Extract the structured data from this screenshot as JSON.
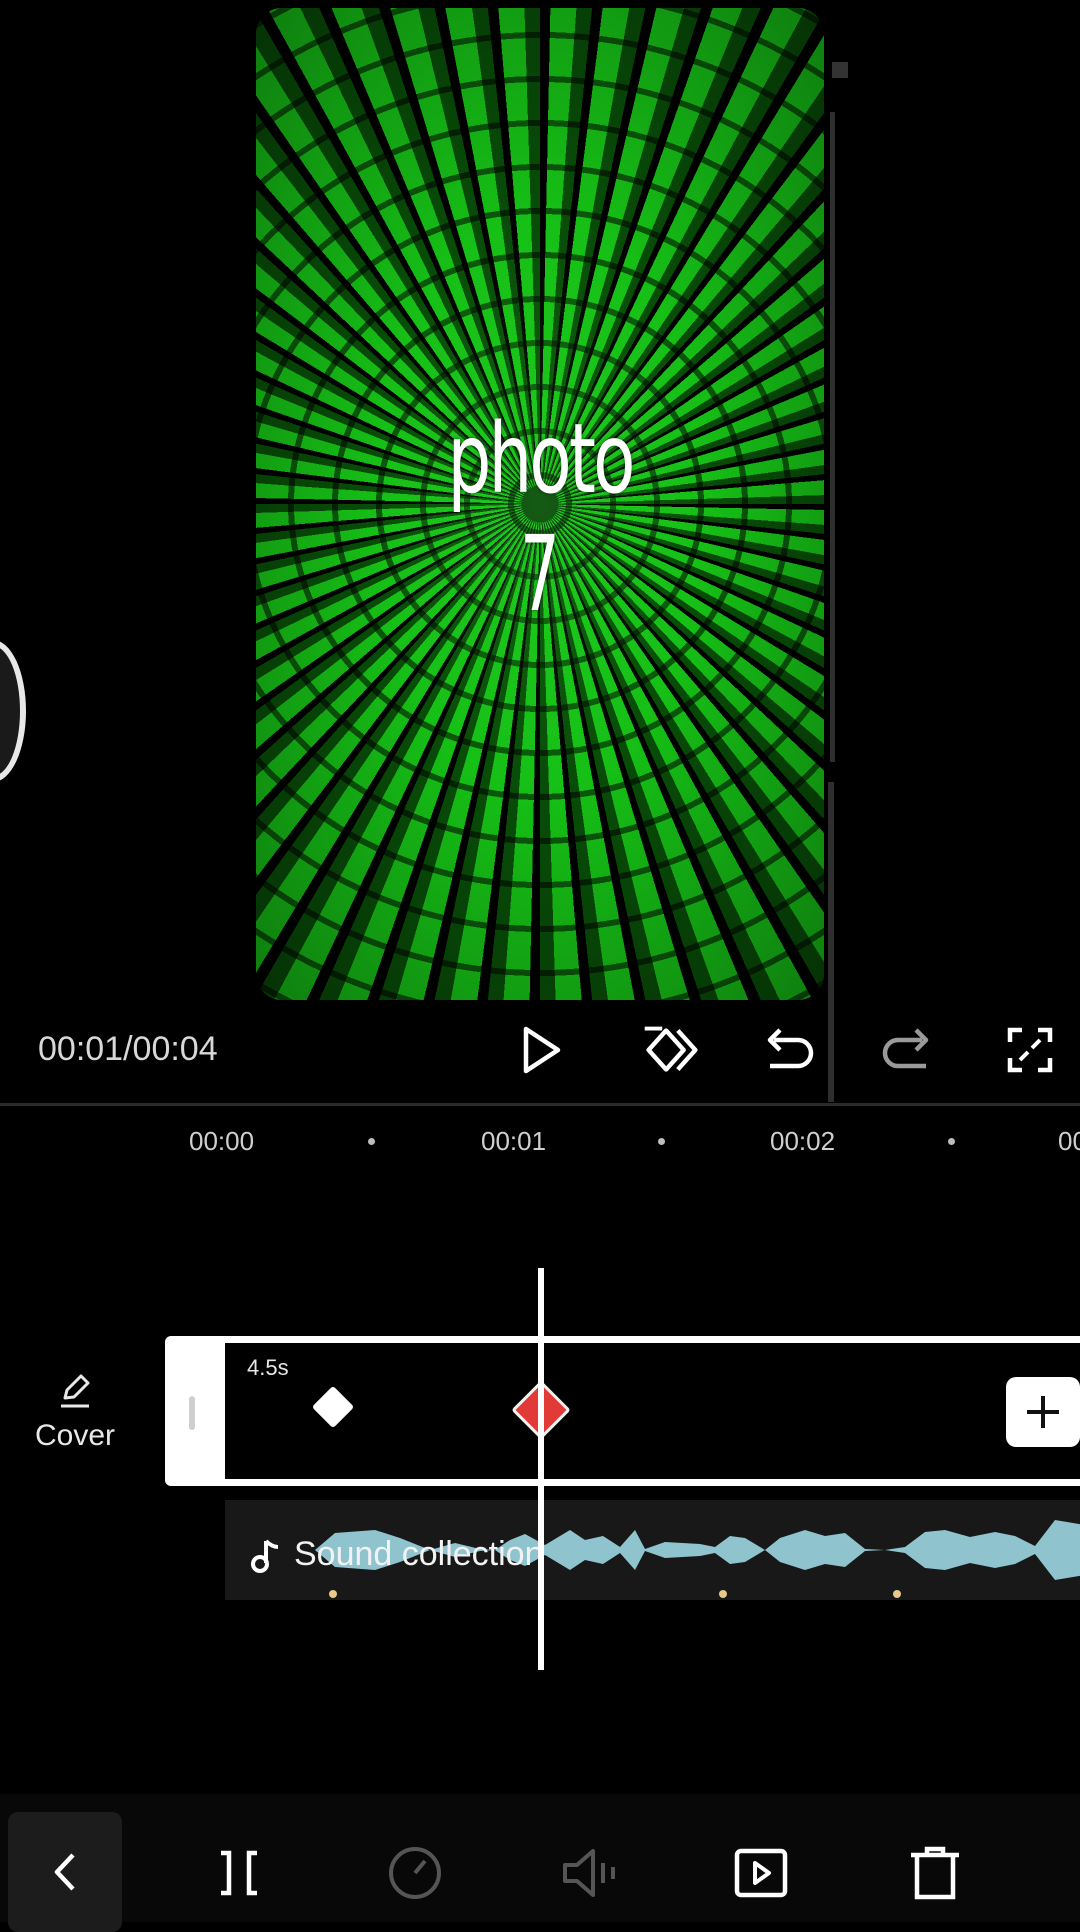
{
  "preview": {
    "overlay_line1": "photo",
    "overlay_line2": "7"
  },
  "playback": {
    "time_readout": "00:01/00:04"
  },
  "ruler": {
    "labels": [
      "00:00",
      "00:01",
      "00:02",
      "00"
    ]
  },
  "cover": {
    "label": "Cover"
  },
  "clip": {
    "duration": "4.5s"
  },
  "audio": {
    "label": "Sound collection"
  },
  "colors": {
    "background": "#000000",
    "keyframe_active": "#e23a36",
    "waveform": "#8fc4cf",
    "preview_green": "#16c016"
  },
  "icons": {
    "controls": [
      "play-icon",
      "keyframe-icon",
      "undo-icon",
      "redo-icon",
      "fullscreen-icon"
    ],
    "toolbar": [
      "back-icon",
      "split-icon",
      "speed-icon",
      "volume-icon",
      "animation-icon",
      "delete-icon"
    ]
  }
}
